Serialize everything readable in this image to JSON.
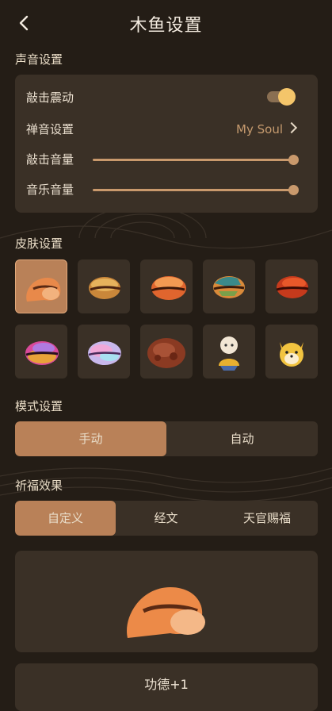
{
  "header": {
    "title": "木鱼设置",
    "back_icon": "chevron-left-icon"
  },
  "sound": {
    "section_title": "声音设置",
    "vibration_label": "敲击震动",
    "vibration_on": true,
    "zen_sound_label": "禅音设置",
    "zen_sound_value": "My Soul",
    "knock_volume_label": "敲击音量",
    "knock_volume": 1.0,
    "music_volume_label": "音乐音量",
    "music_volume": 1.0
  },
  "skins": {
    "section_title": "皮肤设置",
    "selected_index": 0,
    "items": [
      {
        "icon": "woodfish-orange-icon"
      },
      {
        "icon": "woodfish-bronze-icon"
      },
      {
        "icon": "woodfish-gradient-icon"
      },
      {
        "icon": "woodfish-earth-icon"
      },
      {
        "icon": "woodfish-red-icon"
      },
      {
        "icon": "woodfish-rainbow-icon"
      },
      {
        "icon": "woodfish-pastel-icon"
      },
      {
        "icon": "woodfish-carved-icon"
      },
      {
        "icon": "monk-icon"
      },
      {
        "icon": "doge-icon"
      }
    ]
  },
  "mode": {
    "section_title": "模式设置",
    "options": [
      "手动",
      "自动"
    ],
    "active": 0
  },
  "blessing": {
    "section_title": "祈福效果",
    "options": [
      "自定义",
      "经文",
      "天官赐福"
    ],
    "active": 0
  },
  "preview": {
    "icon": "woodfish-preview-icon"
  },
  "merit_text": "功德+1",
  "colors": {
    "accent": "#b98158",
    "card": "#3a3026",
    "background": "#241d16",
    "toggle_knob": "#f4c56a"
  }
}
